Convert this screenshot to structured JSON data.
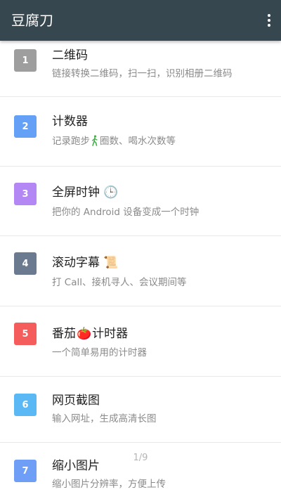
{
  "app": {
    "title": "豆腐刀",
    "menu_icon": "more-vert-icon"
  },
  "items": [
    {
      "index": "1",
      "title": "二维码",
      "emoji": "",
      "desc": "链接转换二维码，扫一扫，识别相册二维码",
      "color": "#9e9e9e"
    },
    {
      "index": "2",
      "title": "计数器",
      "emoji": "",
      "desc_before": "记录跑步",
      "desc_icon": "walking-person-icon",
      "desc_after": "圈数、喝水次数等",
      "color": "#64a0f5"
    },
    {
      "index": "3",
      "title": "全屏时钟",
      "emoji": "🕒",
      "desc": "把你的 Android 设备变成一个时钟",
      "color": "#b388f5"
    },
    {
      "index": "4",
      "title": "滚动字幕",
      "emoji": "📜",
      "desc": "打 Call、接机寻人、会议期间等",
      "color": "#6b7a8f"
    },
    {
      "index": "5",
      "title_before": "番茄",
      "emoji": "🍅",
      "title_after": "计时器",
      "desc": "一个简单易用的计时器",
      "color": "#f55c5c"
    },
    {
      "index": "6",
      "title": "网页截图",
      "emoji": "",
      "desc": "输入网址，生成高清长图",
      "color": "#5ab8f5"
    },
    {
      "index": "7",
      "title": "缩小图片",
      "emoji": "",
      "desc": "缩小图片分辨率，方便上传",
      "color": "#6e9ef5"
    }
  ],
  "page_indicator": "1/9"
}
